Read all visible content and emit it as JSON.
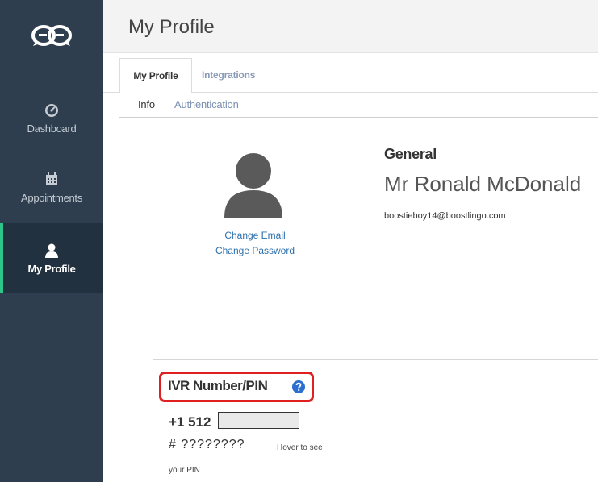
{
  "sidebar": {
    "logo_icon": "boostlingo-logo-icon",
    "items": [
      {
        "label": "Dashboard",
        "icon": "gauge-icon"
      },
      {
        "label": "Appointments",
        "icon": "calendar-icon"
      },
      {
        "label": "My Profile",
        "icon": "user-icon",
        "active": true
      }
    ],
    "active_color": "#2ec58a"
  },
  "header": {
    "title": "My Profile"
  },
  "tabs": [
    {
      "label": "My Profile",
      "active": true
    },
    {
      "label": "Integrations"
    }
  ],
  "subtabs": [
    {
      "label": "Info",
      "active": true
    },
    {
      "label": "Authentication"
    }
  ],
  "profile": {
    "change_email": "Change Email",
    "change_password": "Change Password",
    "section_title": "General",
    "full_name": "Mr Ronald McDonald",
    "email": "boostieboy14@boostlingo.com"
  },
  "ivr": {
    "label": "IVR Number/PIN",
    "help_icon": "question-circle-icon",
    "phone_prefix": "+1 512",
    "pin_hash": "#",
    "pin_masked": "????????",
    "hover_hint_1": "Hover to see",
    "hover_hint_2": "your PIN",
    "highlight_color": "#e02020"
  }
}
